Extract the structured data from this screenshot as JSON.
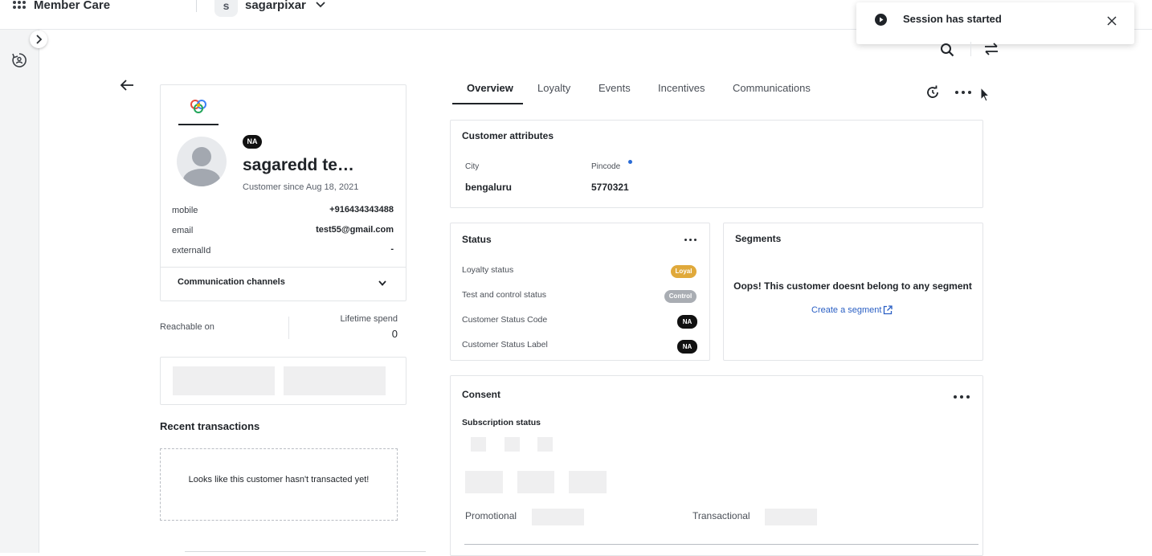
{
  "app": {
    "title": "Member Care"
  },
  "user": {
    "initial": "s",
    "name": "sagarpixar"
  },
  "toast": {
    "message": "Session has started"
  },
  "profile": {
    "badge": "NA",
    "name": "sagaredd te…",
    "customer_since": "Customer since Aug 18, 2021",
    "fields": [
      {
        "label": "mobile",
        "value": "+916434343488"
      },
      {
        "label": "email",
        "value": "test55@gmail.com"
      },
      {
        "label": "externalId",
        "value": "-"
      }
    ],
    "communication_channels": "Communication channels",
    "reachable_on": "Reachable on",
    "lifetime_spend_label": "Lifetime spend",
    "lifetime_spend_value": "0"
  },
  "recent_transactions": {
    "title": "Recent transactions",
    "empty": "Looks like this customer hasn't transacted yet!"
  },
  "tabs": [
    {
      "label": "Overview"
    },
    {
      "label": "Loyalty"
    },
    {
      "label": "Events"
    },
    {
      "label": "Incentives"
    },
    {
      "label": "Communications"
    }
  ],
  "customer_attributes": {
    "title": "Customer attributes",
    "items": [
      {
        "label": "City",
        "value": "bengaluru"
      },
      {
        "label": "Pincode",
        "value": "5770321"
      }
    ]
  },
  "status": {
    "title": "Status",
    "rows": [
      {
        "label": "Loyalty status",
        "value": "Loyal",
        "color": "#e0a93b"
      },
      {
        "label": "Test and control status",
        "value": "Control",
        "color": "#a9adb3"
      },
      {
        "label": "Customer Status Code",
        "value": "NA",
        "color": "#111111"
      },
      {
        "label": "Customer Status Label",
        "value": "NA",
        "color": "#111111"
      }
    ]
  },
  "segments": {
    "title": "Segments",
    "empty": "Oops! This customer doesnt belong to any segment",
    "link": "Create a segment"
  },
  "consent": {
    "title": "Consent",
    "subscription_status": "Subscription status",
    "promotional": "Promotional",
    "transactional": "Transactional"
  },
  "colors": {
    "accent": "#1f2328",
    "link": "#2a5fc4"
  }
}
